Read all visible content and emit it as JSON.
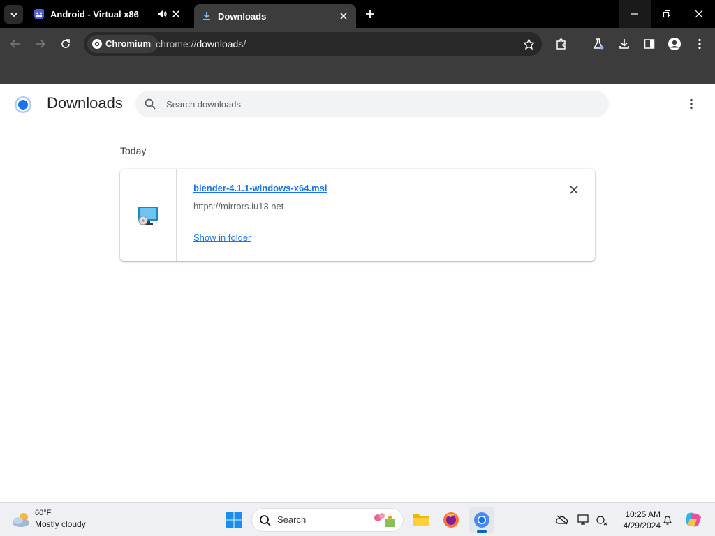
{
  "tabs": [
    {
      "title": "Android - Virtual x86",
      "active": false,
      "audio": true
    },
    {
      "title": "Downloads",
      "active": true,
      "audio": false
    }
  ],
  "toolbar": {
    "site_chip": "Chromium",
    "url_scheme": "chrome://",
    "url_host": "downloads",
    "url_path": "/"
  },
  "downloads_page": {
    "heading": "Downloads",
    "search_placeholder": "Search downloads",
    "date_header": "Today",
    "items": [
      {
        "filename": "blender-4.1.1-windows-x64.msi",
        "source_url": "https://mirrors.iu13.net",
        "action_label": "Show in folder"
      }
    ]
  },
  "taskbar": {
    "weather": {
      "temperature": "60°F",
      "condition": "Mostly cloudy"
    },
    "search_label": "Search",
    "clock": {
      "time": "10:25 AM",
      "date": "4/29/2024"
    }
  },
  "colors": {
    "titlebar": "#000000",
    "toolbar": "#3c3c3c",
    "link": "#1a73e8",
    "taskbar": "#eef0f3"
  },
  "icons": [
    "tab-search-icon",
    "android-favicon",
    "audio-icon",
    "close-icon",
    "downloads-favicon",
    "plus-icon",
    "minimize-icon",
    "maximize-icon",
    "back-icon",
    "forward-icon",
    "reload-icon",
    "chromium-icon",
    "star-icon",
    "extensions-icon",
    "labs-icon",
    "download-icon",
    "side-panel-icon",
    "profile-icon",
    "menu-icon",
    "search-icon",
    "installer-file-icon",
    "windows-start-icon",
    "file-explorer-icon",
    "firefox-icon",
    "chromium-icon",
    "onedrive-icon",
    "display-icon",
    "network-icon",
    "bell-icon",
    "copilot-icon"
  ]
}
